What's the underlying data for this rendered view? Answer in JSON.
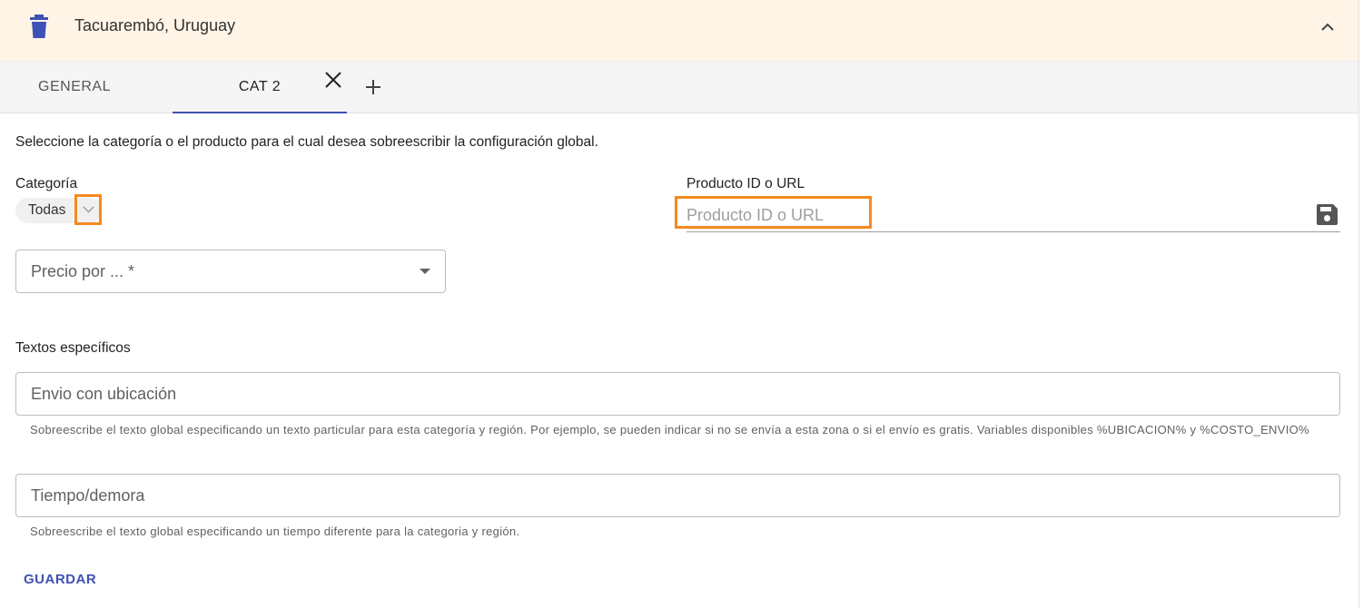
{
  "header": {
    "title": "Tacuarembó, Uruguay"
  },
  "tabs": [
    {
      "label": "GENERAL"
    },
    {
      "label": "CAT 2",
      "active": true
    }
  ],
  "form": {
    "intro": "Seleccione la categoría o el producto para el cual desea sobreescribir la configuración global.",
    "categoria_label": "Categoría",
    "categoria_value": "Todas",
    "producto_label": "Producto ID o URL",
    "producto_placeholder": "Producto ID o URL",
    "precio_placeholder": "Precio por ... *",
    "textos_heading": "Textos específicos",
    "envio_placeholder": "Envio con ubicación",
    "envio_helper": "Sobreescribe el texto global especificando un texto particular para esta categoría y región. Por ejemplo, se pueden indicar si no se envía a esta zona o si el envío es gratis. Variables disponibles %UBICACION% y %COSTO_ENVIO%",
    "tiempo_placeholder": "Tiempo/demora",
    "tiempo_helper": "Sobreescribe el texto global especificando un tiempo diferente para la categoria y región.",
    "save_label": "GUARDAR"
  },
  "colors": {
    "accent": "#3f51b5",
    "header_bg": "#fff4e6",
    "highlight": "#f5891f"
  },
  "icons": [
    "trash-icon",
    "chevron-up-icon",
    "close-icon",
    "plus-icon",
    "chevron-down-icon",
    "save-icon",
    "dropdown-arrow-icon"
  ]
}
